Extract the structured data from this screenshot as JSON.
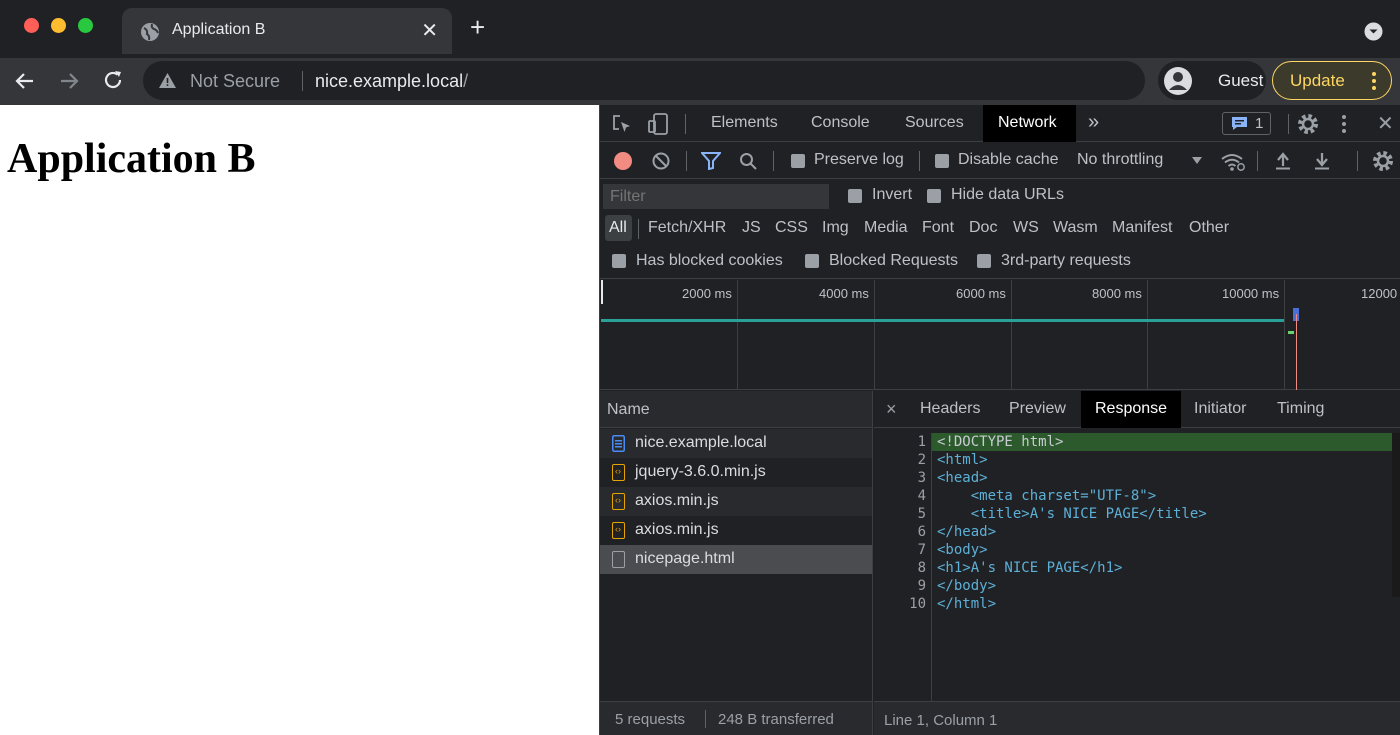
{
  "browser": {
    "tab_title": "Application B",
    "new_tab": "+",
    "security_label": "Not Secure",
    "url_host": "nice.example.local",
    "url_path": "/",
    "profile_label": "Guest",
    "update_label": "Update"
  },
  "page": {
    "heading": "Application B"
  },
  "devtools": {
    "tabs": [
      "Elements",
      "Console",
      "Sources",
      "Network"
    ],
    "active_tab": "Network",
    "more_tabs": "»",
    "issues_count": "1",
    "toolbar": {
      "preserve_log": "Preserve log",
      "disable_cache": "Disable cache",
      "throttling": "No throttling"
    },
    "filter": {
      "placeholder": "Filter",
      "invert": "Invert",
      "hide_data_urls": "Hide data URLs"
    },
    "type_filters": [
      "All",
      "Fetch/XHR",
      "JS",
      "CSS",
      "Img",
      "Media",
      "Font",
      "Doc",
      "WS",
      "Wasm",
      "Manifest",
      "Other"
    ],
    "checks": {
      "blocked_cookies": "Has blocked cookies",
      "blocked_requests": "Blocked Requests",
      "third_party": "3rd-party requests"
    },
    "timeline_ticks": [
      "2000 ms",
      "4000 ms",
      "6000 ms",
      "8000 ms",
      "10000 ms",
      "12000"
    ],
    "name_header": "Name",
    "requests": [
      {
        "name": "nice.example.local",
        "type": "document"
      },
      {
        "name": "jquery-3.6.0.min.js",
        "type": "script"
      },
      {
        "name": "axios.min.js",
        "type": "script"
      },
      {
        "name": "axios.min.js",
        "type": "script"
      },
      {
        "name": "nicepage.html",
        "type": "other"
      }
    ],
    "detail_tabs": [
      "Headers",
      "Preview",
      "Response",
      "Initiator",
      "Timing"
    ],
    "active_detail_tab": "Response",
    "close_detail": "×",
    "response_lines": [
      "<!DOCTYPE html>",
      "<html>",
      "<head>",
      "    <meta charset=\"UTF-8\">",
      "    <title>A's NICE PAGE</title>",
      "</head>",
      "<body>",
      "<h1>A's NICE PAGE</h1>",
      "</body>",
      "</html>"
    ],
    "line_numbers": [
      "1",
      "2",
      "3",
      "4",
      "5",
      "6",
      "7",
      "8",
      "9",
      "10"
    ],
    "status_requests": "5 requests",
    "status_transferred": "248 B transferred",
    "status_cursor": "Line 1, Column 1"
  },
  "colors": {
    "accent": "#8ab4f8",
    "update": "#fdd663",
    "record": "#f28b82"
  }
}
